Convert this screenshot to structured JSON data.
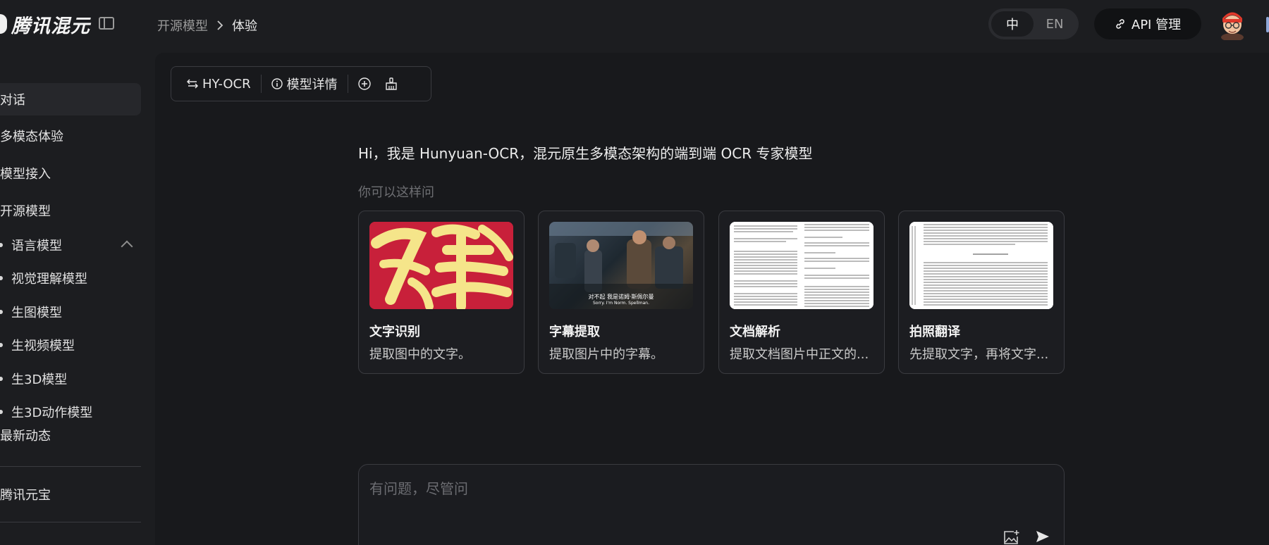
{
  "header": {
    "brand": "腾讯混元",
    "breadcrumb_parent": "开源模型",
    "breadcrumb_current": "体验",
    "lang_zh": "中",
    "lang_en": "EN",
    "api_label": "API 管理"
  },
  "sidebar": {
    "items": [
      {
        "label": "对话",
        "active": true
      },
      {
        "label": "多模态体验"
      },
      {
        "label": "模型接入"
      },
      {
        "label": "开源模型",
        "expanded": true
      }
    ],
    "subitems": [
      {
        "label": "语言模型"
      },
      {
        "label": "视觉理解模型"
      },
      {
        "label": "生图模型"
      },
      {
        "label": "生视频模型"
      },
      {
        "label": "生3D模型"
      },
      {
        "label": "生3D动作模型"
      }
    ],
    "news": "最新动态",
    "yuanbao": "腾讯元宝"
  },
  "toolbar": {
    "model_name": "HY-OCR",
    "details_label": "模型详情"
  },
  "welcome": {
    "greeting": "Hi，我是 Hunyuan-OCR，混元原生多模态架构的端到端 OCR 专家模型",
    "hint": "你可以这样问"
  },
  "cards": [
    {
      "title": "文字识别",
      "desc": "提取图中的文字。"
    },
    {
      "title": "字幕提取",
      "desc": "提取图片中的字幕。",
      "subtitle_zh": "对不起 我是诺姆·斯佩尔曼",
      "subtitle_en": "Sorry. I'm Norm. Spellman."
    },
    {
      "title": "文档解析",
      "desc": "提取文档图片中正文的..."
    },
    {
      "title": "拍照翻译",
      "desc": "先提取文字，再将文字..."
    }
  ],
  "input": {
    "placeholder": "有问题，尽管问"
  },
  "colors": {
    "background": "#1c1d20",
    "panel": "#18191c",
    "calligraphy_red": "#c8203a",
    "calligraphy_yellow": "#f5e58a"
  }
}
